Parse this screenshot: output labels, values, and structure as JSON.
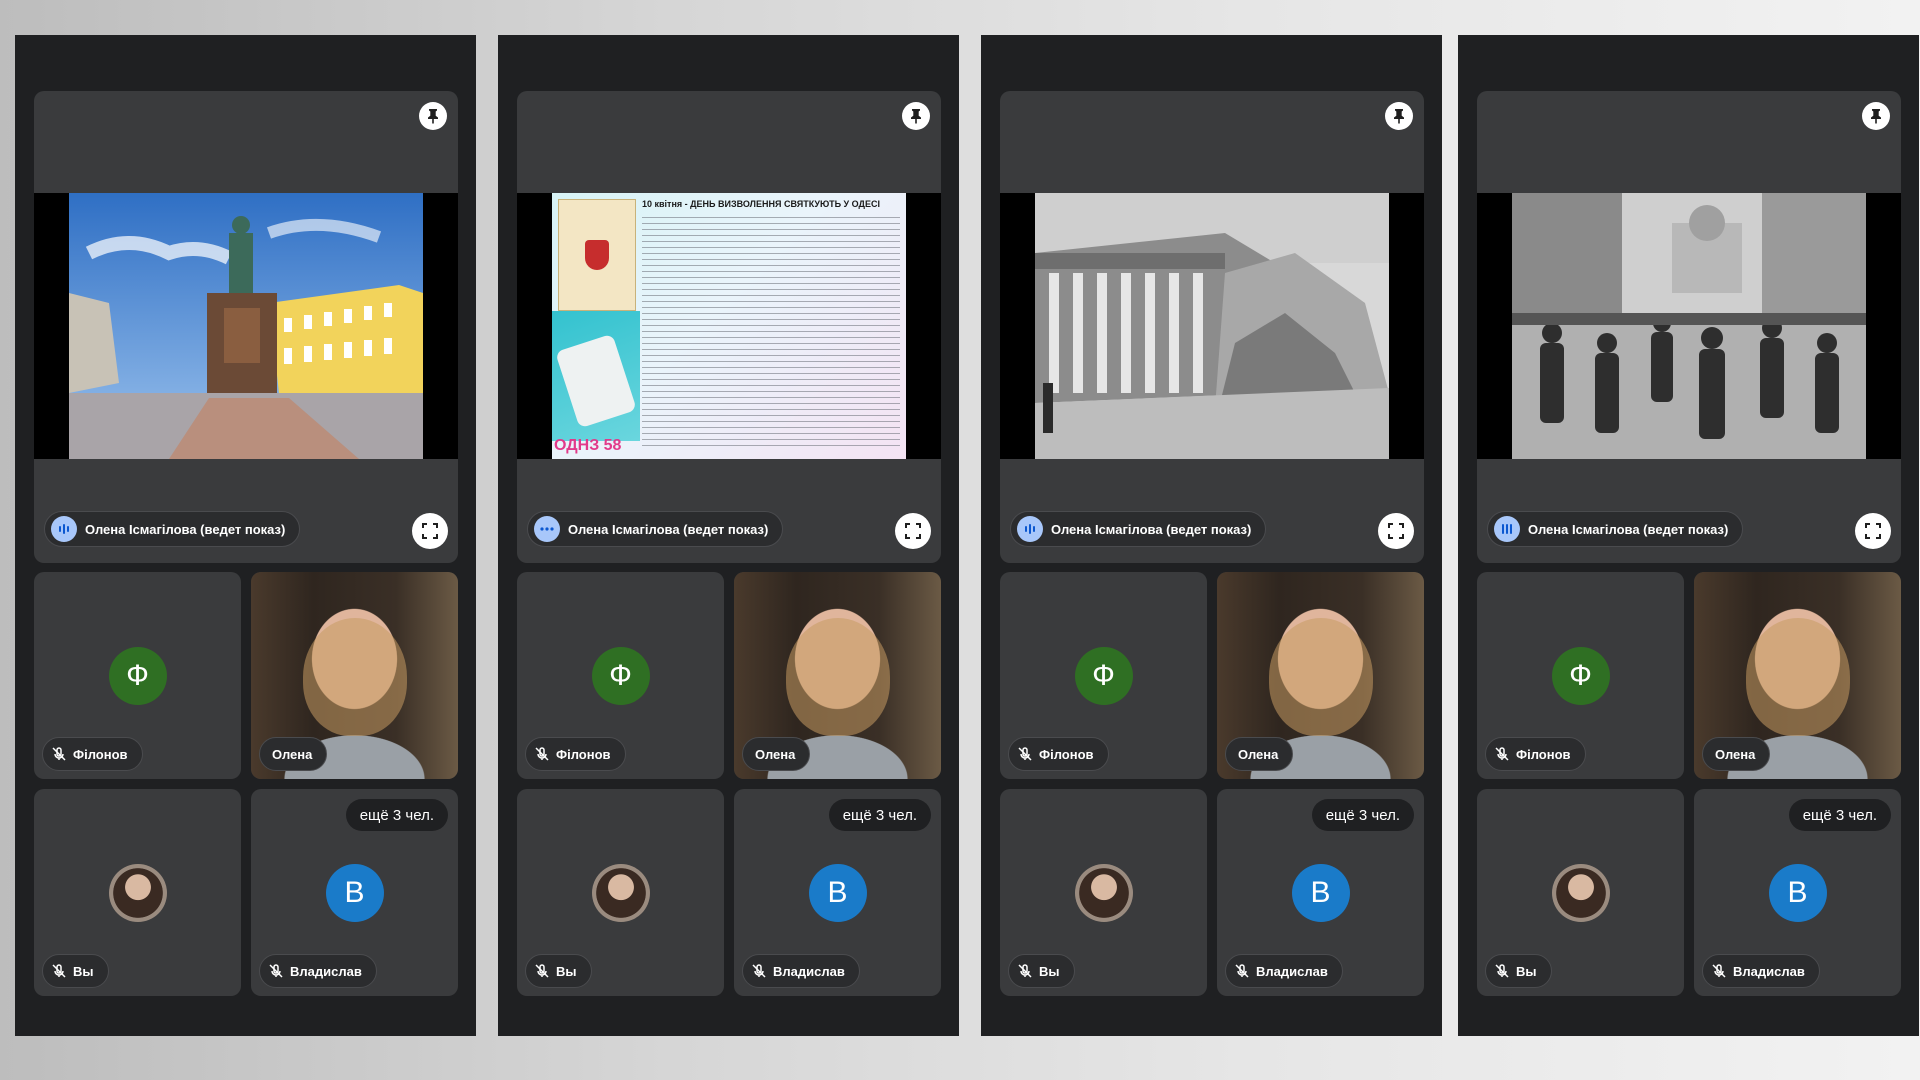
{
  "colors": {
    "panel_bg": "#1f2022",
    "tile_bg": "#3a3b3d",
    "speaking_accent": "#a8c7fa",
    "avatar_filonov": "#2f6f23",
    "avatar_vladyslav": "#1a7bc9"
  },
  "icons": {
    "pin": "pin-icon",
    "speaking": "speaking-indicator-icon",
    "fullscreen": "fullscreen-icon",
    "mic_off": "mic-off-icon"
  },
  "screens": [
    {
      "presenter": "Олена Ісмагілова (ведет показ)",
      "slide": "duke-monument",
      "tiles": [
        {
          "name": "Філонов",
          "initial": "Ф"
        },
        {
          "name": "Олена"
        },
        {
          "name": "Вы"
        },
        {
          "name": "Владислав",
          "initial": "В",
          "more": "ещё 3 чел."
        }
      ]
    },
    {
      "presenter": "Олена Ісмагілова (ведет показ)",
      "slide": "newspaper",
      "slide_title": "10 квітня - ДЕНЬ ВИЗВОЛЕННЯ СВЯТКУЮТЬ У ОДЕСІ",
      "slide_badge": "ОДНЗ 58",
      "tiles": [
        {
          "name": "Філонов",
          "initial": "Ф"
        },
        {
          "name": "Олена"
        },
        {
          "name": "Вы"
        },
        {
          "name": "Владислав",
          "initial": "В",
          "more": "ещё 3 чел."
        }
      ]
    },
    {
      "presenter": "Олена Ісмагілова (ведет показ)",
      "slide": "ruins",
      "tiles": [
        {
          "name": "Філонов",
          "initial": "Ф"
        },
        {
          "name": "Олена"
        },
        {
          "name": "Вы"
        },
        {
          "name": "Владислав",
          "initial": "В",
          "more": "ещё 3 чел."
        }
      ]
    },
    {
      "presenter": "Олена Ісмагілова (ведет показ)",
      "slide": "soldiers",
      "tiles": [
        {
          "name": "Філонов",
          "initial": "Ф"
        },
        {
          "name": "Олена"
        },
        {
          "name": "Вы"
        },
        {
          "name": "Владислав",
          "initial": "В",
          "more": "ещё 3 чел."
        }
      ]
    }
  ]
}
